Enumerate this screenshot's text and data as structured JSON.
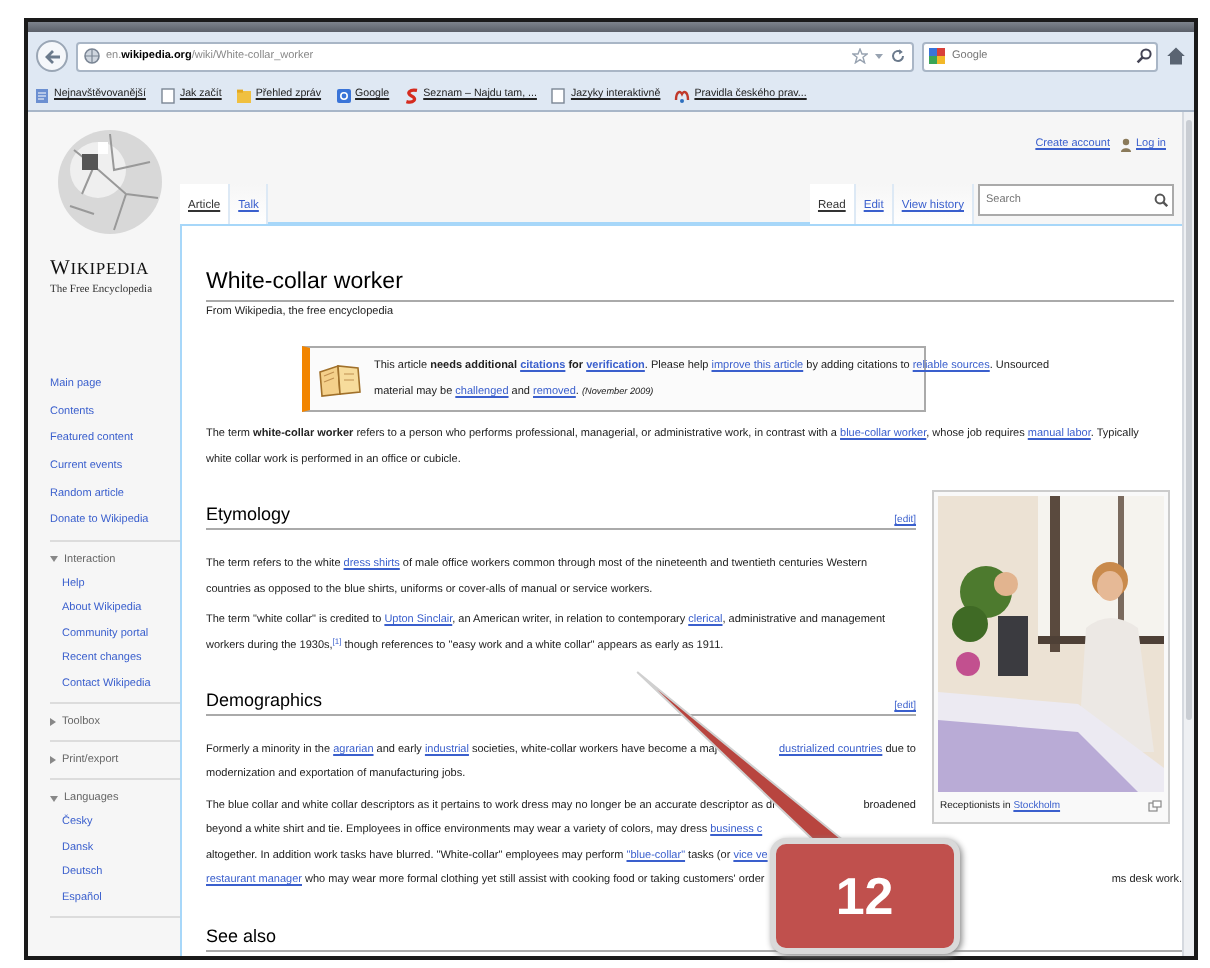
{
  "browser": {
    "url": {
      "prefix": "en.",
      "domain": "wikipedia.org",
      "path": "/wiki/White-collar_worker"
    },
    "search_placeholder": "Google",
    "bookmarks": [
      {
        "label": "Nejnavštěvovanější",
        "kind": "history"
      },
      {
        "label": "Jak začít",
        "kind": "page"
      },
      {
        "label": "Přehled zpráv",
        "kind": "feed"
      },
      {
        "label": "Google",
        "kind": "google"
      },
      {
        "label": "Seznam – Najdu tam, ...",
        "kind": "seznam"
      },
      {
        "label": "Jazyky interaktivně",
        "kind": "page"
      },
      {
        "label": "Pravidla českého prav...",
        "kind": "site"
      }
    ]
  },
  "wiki": {
    "personal": [
      {
        "label": "Create account",
        "kind": "plain"
      },
      {
        "label": "Log in",
        "kind": "user"
      }
    ],
    "logo": {
      "wordmark": "WIKIPEDIA",
      "tagline": "The Free Encyclopedia"
    },
    "navigation": [
      "Main page",
      "Contents",
      "Featured content",
      "Current events",
      "Random article",
      "Donate to Wikipedia"
    ],
    "portals": [
      {
        "label": "Interaction",
        "expanded": true,
        "items": [
          "Help",
          "About Wikipedia",
          "Community portal",
          "Recent changes",
          "Contact Wikipedia"
        ]
      },
      {
        "label": "Toolbox",
        "expanded": false
      },
      {
        "label": "Print/export",
        "expanded": false
      },
      {
        "label": "Languages",
        "expanded": true,
        "items": [
          "Česky",
          "Dansk",
          "Deutsch",
          "Español"
        ]
      }
    ],
    "namespaces": [
      {
        "label": "Article",
        "selected": true
      },
      {
        "label": "Talk",
        "selected": false
      }
    ],
    "views": [
      {
        "label": "Read",
        "selected": true
      },
      {
        "label": "Edit",
        "selected": false
      },
      {
        "label": "View history",
        "selected": false
      }
    ],
    "search_placeholder": "Search"
  },
  "article": {
    "title": "White-collar worker",
    "tagline": "From Wikipedia, the free encyclopedia",
    "notice": [
      [
        {
          "kind": "text",
          "text": "This article "
        },
        {
          "kind": "bold",
          "text": "needs additional "
        },
        {
          "kind": "strong-link",
          "text": "citations"
        },
        {
          "kind": "bold",
          "text": " for "
        },
        {
          "kind": "strong-link",
          "text": "verification"
        },
        {
          "kind": "text",
          "text": ". Please help "
        },
        {
          "kind": "link",
          "text": "improve this article"
        },
        {
          "kind": "text",
          "text": " by adding citations to "
        },
        {
          "kind": "link",
          "text": "reliable sources"
        },
        {
          "kind": "text",
          "text": ". Unsourced"
        }
      ],
      [
        {
          "kind": "text",
          "text": "material may be "
        },
        {
          "kind": "link",
          "text": "challenged"
        },
        {
          "kind": "text",
          "text": " and "
        },
        {
          "kind": "link",
          "text": "removed"
        },
        {
          "kind": "text",
          "text": ". "
        },
        {
          "kind": "note",
          "text": "(November 2009)"
        }
      ]
    ],
    "lead": [
      {
        "runs": [
          {
            "kind": "text",
            "text": "The term "
          },
          {
            "kind": "bold",
            "text": "white-collar worker"
          },
          {
            "kind": "text",
            "text": " refers to a person who performs professional, managerial, or administrative work, in contrast with a "
          },
          {
            "kind": "link",
            "text": "blue-collar worker"
          },
          {
            "kind": "text",
            "text": ", whose job requires "
          },
          {
            "kind": "link",
            "text": "manual labor"
          },
          {
            "kind": "text",
            "text": ". Typically"
          }
        ]
      },
      {
        "runs": [
          {
            "kind": "text",
            "text": "white collar work is performed in an office or cubicle."
          }
        ]
      }
    ],
    "figure": {
      "caption": [
        {
          "kind": "text",
          "text": "Receptionists in "
        },
        {
          "kind": "link",
          "text": "Stockholm"
        }
      ]
    },
    "sections": [
      {
        "heading": "Etymology",
        "edit": "[edit]",
        "paragraphs": [
          [
            {
              "runs": [
                {
                  "kind": "text",
                  "text": "The term refers to the white "
                },
                {
                  "kind": "link",
                  "text": "dress shirts"
                },
                {
                  "kind": "text",
                  "text": " of male office workers common through most of the nineteenth and twentieth centuries Western"
                }
              ]
            },
            {
              "runs": [
                {
                  "kind": "text",
                  "text": "countries as opposed to the blue shirts, uniforms or cover-alls of manual or service workers."
                }
              ]
            }
          ],
          [
            {
              "runs": [
                {
                  "kind": "text",
                  "text": "The term \"white collar\" is credited to "
                },
                {
                  "kind": "link",
                  "text": "Upton Sinclair"
                },
                {
                  "kind": "text",
                  "text": ", an American writer, in relation to contemporary "
                },
                {
                  "kind": "link",
                  "text": "clerical"
                },
                {
                  "kind": "text",
                  "text": ", administrative and management"
                }
              ]
            },
            {
              "runs": [
                {
                  "kind": "text",
                  "text": "workers during the 1930s,"
                },
                {
                  "kind": "ref",
                  "text": "[1]"
                },
                {
                  "kind": "text",
                  "text": " though references to \"easy work and a white collar\" appears as early as 1911."
                }
              ]
            }
          ]
        ]
      },
      {
        "heading": "Demographics",
        "edit": "[edit]",
        "paragraphs": [
          [
            {
              "runs": [
                {
                  "kind": "text",
                  "text": "Formerly a minority in the "
                },
                {
                  "kind": "link",
                  "text": "agrarian"
                },
                {
                  "kind": "text",
                  "text": " and early "
                },
                {
                  "kind": "link",
                  "text": "industrial"
                },
                {
                  "kind": "text",
                  "text": " societies, white-collar workers have become a maj"
                }
              ],
              "after": [
                {
                  "kind": "link",
                  "text": "dustrialized countries"
                },
                {
                  "kind": "text",
                  "text": " due to"
                }
              ]
            },
            {
              "runs": [
                {
                  "kind": "text",
                  "text": "modernization and exportation of manufacturing jobs."
                }
              ]
            }
          ],
          [
            {
              "runs": [
                {
                  "kind": "text",
                  "text": "The blue collar and white collar descriptors as it pertains to work dress may no longer be an accurate descriptor as dr"
                }
              ],
              "after": [
                {
                  "kind": "text",
                  "text": "broadened"
                }
              ]
            },
            {
              "runs": [
                {
                  "kind": "text",
                  "text": "beyond a white shirt and tie. Employees in office environments may wear a variety of colors, may dress "
                },
                {
                  "kind": "link",
                  "text": "business c"
                }
              ]
            },
            {
              "runs": [
                {
                  "kind": "text",
                  "text": "altogether. In addition work tasks have blurred. \"White-collar\" employees may perform "
                },
                {
                  "kind": "link",
                  "text": "\"blue-collar\""
                },
                {
                  "kind": "text",
                  "text": " tasks (or "
                },
                {
                  "kind": "link",
                  "text": "vice ve"
                }
              ]
            },
            {
              "runs": [
                {
                  "kind": "link",
                  "text": "restaurant manager"
                },
                {
                  "kind": "text",
                  "text": " who may wear more formal clothing yet still assist with cooking food or taking customers' order"
                }
              ],
              "after": [
                {
                  "kind": "text",
                  "text": "ms desk work."
                }
              ]
            }
          ]
        ]
      },
      {
        "heading": "See also"
      }
    ]
  },
  "callout": {
    "number": "12"
  }
}
